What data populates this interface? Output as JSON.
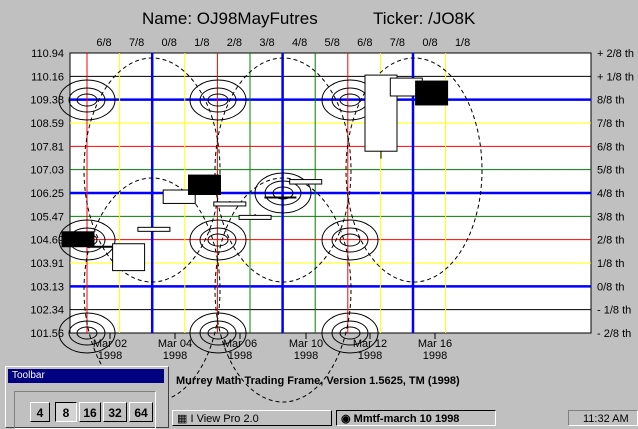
{
  "header": {
    "name_label": "Name: OJ98MayFutres",
    "ticker_label": "Ticker: /JO8K"
  },
  "chart_data": {
    "type": "candlestick",
    "title": "Name: OJ98MayFutres",
    "y_range": [
      101.56,
      110.94
    ],
    "y_ticks": [
      "110.94",
      "110.16",
      "109.38",
      "108.59",
      "107.81",
      "107.03",
      "106.25",
      "105.47",
      "104.69",
      "103.91",
      "103.13",
      "102.34",
      "101.56"
    ],
    "right_ticks": [
      "+ 2/8 th",
      "+ 1/8 th",
      "8/8 th",
      "7/8 th",
      "6/8 th",
      "5/8 th",
      "4/8 th",
      "3/8 th",
      "2/8 th",
      "1/8 th",
      "0/8 th",
      "- 1/8 th",
      "- 2/8 th"
    ],
    "top_ticks": [
      "6/8",
      "7/8",
      "0/8",
      "1/8",
      "2/8",
      "3/8",
      "4/8",
      "5/8",
      "6/8",
      "7/8",
      "0/8",
      "1/8"
    ],
    "x_date_labels": [
      {
        "date": "Mar 02",
        "year": "1998"
      },
      {
        "date": "Mar 04",
        "year": "1998"
      },
      {
        "date": "Mar 06",
        "year": "1998"
      },
      {
        "date": "Mar 10",
        "year": "1998"
      },
      {
        "date": "Mar 12",
        "year": "1998"
      },
      {
        "date": "Mar 16",
        "year": "1998"
      }
    ],
    "bars": [
      {
        "index": 0,
        "open": 104.95,
        "high": 104.95,
        "low": 104.45,
        "close": 104.45,
        "fill": "black"
      },
      {
        "index": 1,
        "open": 104.45,
        "high": 104.45,
        "low": 104.45,
        "close": 104.45,
        "fill": "line"
      },
      {
        "index": 2,
        "open": 103.65,
        "high": 104.55,
        "low": 103.65,
        "close": 104.55,
        "fill": "white"
      },
      {
        "index": 3,
        "open": 105.0,
        "high": 105.1,
        "low": 104.95,
        "close": 105.1,
        "fill": "white"
      },
      {
        "index": 4,
        "open": 105.9,
        "high": 106.35,
        "low": 105.9,
        "close": 106.35,
        "fill": "white"
      },
      {
        "index": 5,
        "open": 106.85,
        "high": 106.85,
        "low": 106.2,
        "close": 106.2,
        "fill": "black"
      },
      {
        "index": 6,
        "open": 105.95,
        "high": 105.98,
        "low": 105.92,
        "close": 105.92,
        "fill": "white"
      },
      {
        "index": 7,
        "open": 105.5,
        "high": 105.55,
        "low": 105.45,
        "close": 105.45,
        "fill": "white"
      },
      {
        "index": 8,
        "open": 106.1,
        "high": 106.1,
        "low": 106.1,
        "close": 106.1,
        "fill": "line"
      },
      {
        "index": 9,
        "open": 106.55,
        "high": 106.7,
        "low": 106.55,
        "close": 106.7,
        "fill": "white"
      },
      {
        "index": 10,
        "open": 107.65,
        "high": 110.2,
        "low": 107.4,
        "close": 110.2,
        "fill": "white"
      },
      {
        "index": 11,
        "open": 109.5,
        "high": 110.1,
        "low": 109.5,
        "close": 110.1,
        "fill": "white"
      },
      {
        "index": 12,
        "open": 110.0,
        "high": 110.0,
        "low": 109.2,
        "close": 109.2,
        "fill": "black"
      }
    ]
  },
  "footer": {
    "version_text": "Murrey Math Trading Frame, Version 1.5625, TM (1998)"
  },
  "toolbar": {
    "title": "Toolbar",
    "zoom_options": [
      "4",
      "8",
      "16",
      "32",
      "64"
    ],
    "active_zoom": "8"
  },
  "taskbar": {
    "items": [
      {
        "label": "I View Pro 2.0",
        "active": false
      },
      {
        "label": "Mmtf-march 10 1998",
        "active": true
      }
    ],
    "clock": "11:32 AM"
  },
  "colors": {
    "red_line": "#ff0000",
    "green_line": "#008000",
    "yellow_line": "#ffff00",
    "blue_line": "#0000ff",
    "black_line": "#000000",
    "window_bg": "#c0c0c0",
    "title_blue": "#000080"
  }
}
